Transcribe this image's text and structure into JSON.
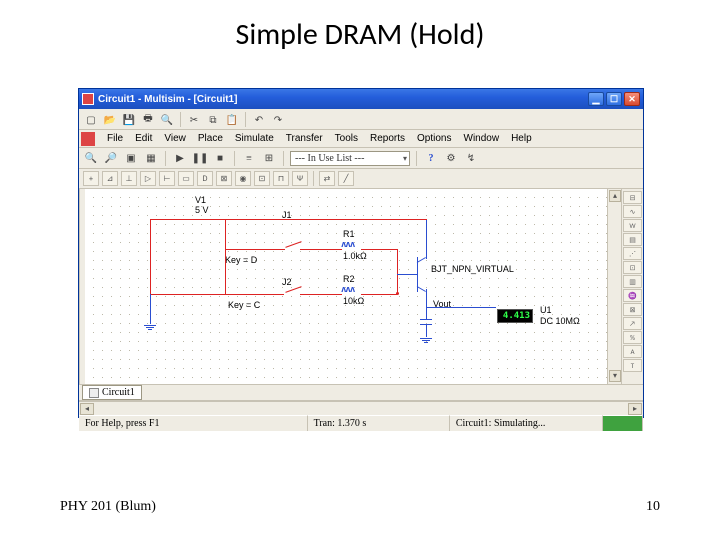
{
  "slide": {
    "title": "Simple DRAM (Hold)",
    "footer_left": "PHY 201 (Blum)",
    "footer_right": "10"
  },
  "window": {
    "title": "Circuit1 - Multisim - [Circuit1]"
  },
  "menu": {
    "file": "File",
    "edit": "Edit",
    "view": "View",
    "place": "Place",
    "simulate": "Simulate",
    "transfer": "Transfer",
    "tools": "Tools",
    "reports": "Reports",
    "options": "Options",
    "window": "Window",
    "help": "Help"
  },
  "toolbar": {
    "combo": "--- In Use List ---"
  },
  "circuit": {
    "v1": {
      "name": "V1",
      "value": "5 V"
    },
    "j1": {
      "name": "J1",
      "key": "Key = D"
    },
    "j2": {
      "name": "J2",
      "key": "Key = C"
    },
    "r1": {
      "name": "R1",
      "value": "1.0kΩ"
    },
    "r2": {
      "name": "R2",
      "value": "10kΩ"
    },
    "q1": {
      "name": "BJT_NPN_VIRTUAL"
    },
    "vout": "Vout",
    "meter": {
      "reading": "4.413"
    },
    "u1": {
      "name": "U1",
      "value": "DC  10MΩ"
    }
  },
  "doctab": {
    "label": "Circuit1"
  },
  "status": {
    "help": "For Help, press F1",
    "tran": "Tran: 1.370 s",
    "sim": "Circuit1: Simulating..."
  }
}
